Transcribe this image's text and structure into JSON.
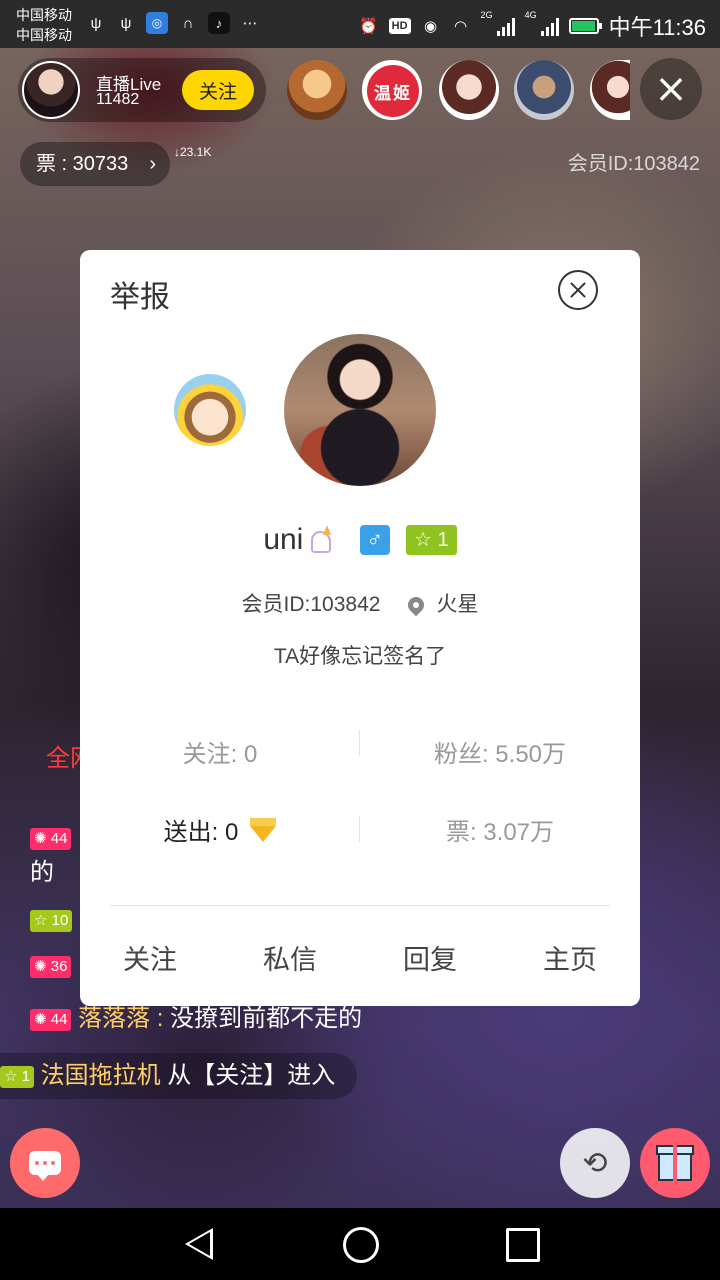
{
  "status_bar": {
    "carrier1": "中国移动",
    "carrier2": "中国移动",
    "hd": "HD",
    "net1": "2G",
    "net2": "4G",
    "time": "中午11:36",
    "battery_level": 0.95,
    "battery_color": "#22c55e"
  },
  "live": {
    "host_name": "直播Live",
    "viewer_count": "11482",
    "follow_label": "关注",
    "viewer_badge_text": "温姬",
    "ticket_label": "票 : 30733",
    "ticket_chevron": "›",
    "ticket_trend": "↓23.1K",
    "member_id": "会员ID:103842",
    "close_icon": "close-icon"
  },
  "chat": {
    "quanwang": "全网",
    "line1_level": "44",
    "line2_text": "的",
    "line3_level": "10",
    "line4_level": "36",
    "line5_level": "44",
    "line5_name": "落落落 :",
    "line5_text": "没撩到前都不走的",
    "line6_level": "1",
    "line6_name": "法国拖拉机",
    "line6_text": "从【关注】进入"
  },
  "card": {
    "title": "举报",
    "username": "uni",
    "gender_symbol": "♂",
    "level": "1",
    "member_id": "会员ID:103842",
    "location": "火星",
    "signature": "TA好像忘记签名了",
    "following": "关注: 0",
    "fans": "粉丝: 5.50万",
    "sent": "送出: 0",
    "tickets": "票: 3.07万",
    "actions": [
      "关注",
      "私信",
      "回复",
      "主页"
    ]
  },
  "colors": {
    "follow_yellow": "#ffd600",
    "gender_blue": "#3aa0e8",
    "level_green": "#8fc31f",
    "chat_pink": "#ff6b6b",
    "gift_red": "#ff5a6e"
  }
}
